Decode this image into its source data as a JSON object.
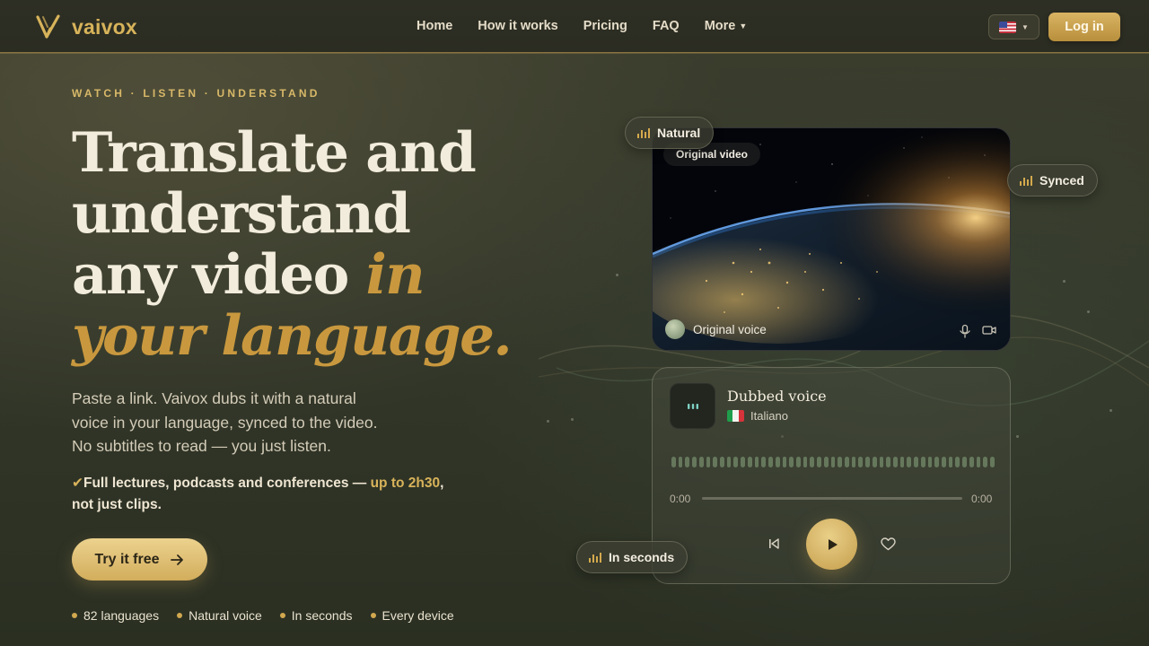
{
  "nav": {
    "brand": "vaivox",
    "links": [
      {
        "label": "Home"
      },
      {
        "label": "How it works"
      },
      {
        "label": "Pricing"
      },
      {
        "label": "FAQ"
      },
      {
        "label": "More"
      }
    ],
    "language_flag": "flag-us-icon",
    "login_label": "Log in"
  },
  "hero": {
    "eyebrow": "WATCH · LISTEN · UNDERSTAND",
    "headline": {
      "line1": "Translate and",
      "line2": "understand",
      "line3_plain": "any video ",
      "line3_accent": "in",
      "line4_accent": "your language."
    },
    "subtitle_lines": [
      "Paste a link. Vaivox dubs it with a natural",
      "voice in your language, synced to the video.",
      "No subtitles to read — you just listen."
    ],
    "feature": {
      "check": "✔",
      "text_before": "Full lectures, podcasts and conferences — ",
      "highlight": "up to 2h30",
      "text_after": ",",
      "line2": "not just clips."
    },
    "cta_label": "Try it free",
    "bullets": [
      "82 languages",
      "Natural voice",
      "In seconds",
      "Every device"
    ]
  },
  "demo": {
    "pills": {
      "natural": "Natural",
      "synced": "Synced",
      "seconds": "In seconds"
    },
    "video": {
      "tag": "Original video",
      "voice_label": "Original voice"
    },
    "dubbed": {
      "title": "Dubbed voice",
      "language": "Italiano",
      "time_current": "0:00",
      "time_total": "0:00"
    }
  },
  "colors": {
    "accent_gold": "#d8b35a",
    "headline_gold": "#c9983e",
    "background": "#34382a"
  }
}
